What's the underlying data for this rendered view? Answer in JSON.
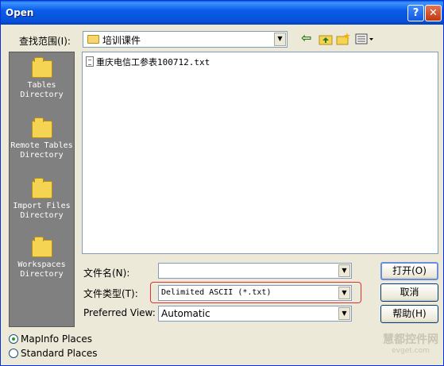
{
  "window": {
    "title": "Open",
    "help_glyph": "?",
    "close_glyph": "✕"
  },
  "toolbar": {
    "look_in_label": "查找范围(I):",
    "look_in_value": "培训课件",
    "back_glyph": "⇦"
  },
  "places": [
    {
      "id": "tables",
      "label": "Tables Directory"
    },
    {
      "id": "remote",
      "label": "Remote Tables Directory"
    },
    {
      "id": "import",
      "label": "Import Files Directory"
    },
    {
      "id": "workspaces",
      "label": "Workspaces Directory"
    }
  ],
  "files": [
    {
      "name": "重庆电信工参表100712.txt"
    }
  ],
  "form": {
    "filename_label": "文件名(N):",
    "filename_value": "",
    "filetype_label": "文件类型(T):",
    "filetype_value": "Delimited ASCII (*.txt)",
    "preferred_label": "Preferred View:",
    "preferred_value": "Automatic"
  },
  "buttons": {
    "open": "打开(O)",
    "cancel": "取消",
    "help": "帮助(H)"
  },
  "radios": [
    {
      "label": "MapInfo Places",
      "checked": true
    },
    {
      "label": "Standard Places",
      "checked": false
    }
  ],
  "watermark": {
    "line1": "慧都控件网",
    "line2": "evget.com"
  },
  "colors": {
    "title_bar": "#0a5ce8",
    "dialog_bg": "#ece9d8",
    "places_bg": "#808080",
    "highlight": "#e03030"
  }
}
